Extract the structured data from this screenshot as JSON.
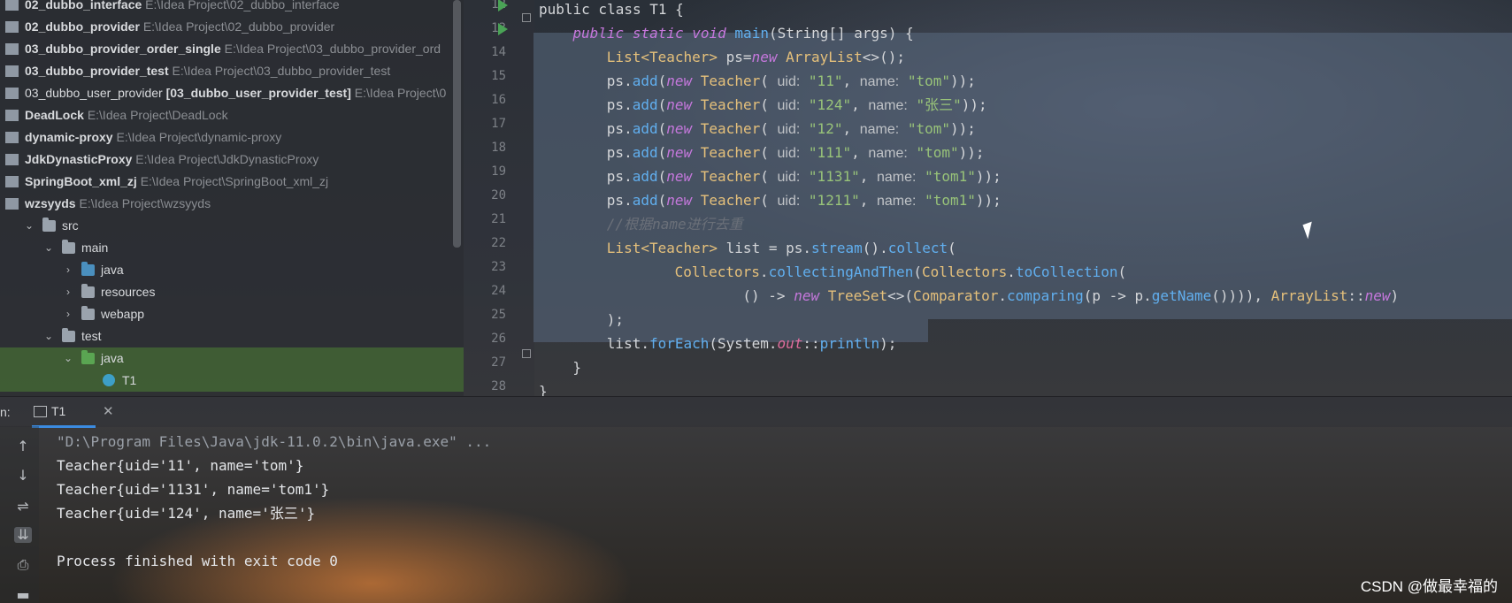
{
  "project_tree": [
    {
      "name": "02_dubbo_interface",
      "path": "E:\\Idea Project\\02_dubbo_interface",
      "bold": true,
      "icon": "module-icon"
    },
    {
      "name": "02_dubbo_provider",
      "path": "E:\\Idea Project\\02_dubbo_provider",
      "bold": true,
      "icon": "module-icon"
    },
    {
      "name": "03_dubbo_provider_order_single",
      "path": "E:\\Idea Project\\03_dubbo_provider_ord",
      "bold": true,
      "icon": "module-icon"
    },
    {
      "name": "03_dubbo_provider_test",
      "path": "E:\\Idea Project\\03_dubbo_provider_test",
      "bold": true,
      "icon": "module-icon"
    },
    {
      "name": "03_dubbo_user_provider",
      "qualifier": "[03_dubbo_user_provider_test]",
      "path": "E:\\Idea Project\\0",
      "bold": false,
      "icon": "module-icon"
    },
    {
      "name": "DeadLock",
      "path": "E:\\Idea Project\\DeadLock",
      "bold": true,
      "icon": "module-icon"
    },
    {
      "name": "dynamic-proxy",
      "path": "E:\\Idea Project\\dynamic-proxy",
      "bold": true,
      "icon": "module-icon"
    },
    {
      "name": "JdkDynasticProxy",
      "path": "E:\\Idea Project\\JdkDynasticProxy",
      "bold": true,
      "icon": "module-icon"
    },
    {
      "name": "SpringBoot_xml_zj",
      "path": "E:\\Idea Project\\SpringBoot_xml_zj",
      "bold": true,
      "icon": "module-icon"
    },
    {
      "name": "wzsyyds",
      "path": "E:\\Idea Project\\wzsyyds",
      "bold": true,
      "icon": "module-icon"
    },
    {
      "name": "src",
      "path": "",
      "bold": false,
      "icon": "folder-icon"
    },
    {
      "name": "main",
      "path": "",
      "bold": false,
      "icon": "folder-icon"
    },
    {
      "name": "java",
      "path": "",
      "bold": false,
      "icon": "folder-blue-icon"
    },
    {
      "name": "resources",
      "path": "",
      "bold": false,
      "icon": "resources-folder-icon"
    },
    {
      "name": "webapp",
      "path": "",
      "bold": false,
      "icon": "web-folder-icon"
    },
    {
      "name": "test",
      "path": "",
      "bold": false,
      "icon": "folder-icon"
    },
    {
      "name": "java",
      "path": "",
      "bold": false,
      "icon": "folder-green-icon"
    },
    {
      "name": "T1",
      "path": "",
      "bold": false,
      "icon": "class-icon"
    }
  ],
  "editor": {
    "line_numbers": [
      "12",
      "13",
      "14",
      "15",
      "16",
      "17",
      "18",
      "19",
      "20",
      "21",
      "22",
      "23",
      "24",
      "25",
      "26",
      "27",
      "28"
    ],
    "code": {
      "l12": "public class T1 {",
      "l13": {
        "kw": "public static void ",
        "mth": "main",
        "rest": "(String[] args) {"
      },
      "l14": {
        "cls1": "List<Teacher>",
        "mid": " ps=",
        "kw": "new ",
        "cls2": "ArrayList",
        "rest": "<>();"
      },
      "adds": [
        {
          "uid": "\"11\"",
          "name": "\"tom\""
        },
        {
          "uid": "\"124\"",
          "name": "\"张三\""
        },
        {
          "uid": "\"12\"",
          "name": "\"tom\""
        },
        {
          "uid": "\"111\"",
          "name": "\"tom\""
        },
        {
          "uid": "\"1131\"",
          "name": "\"tom1\""
        },
        {
          "uid": "\"1211\"",
          "name": "\"tom1\""
        }
      ],
      "add_prefix": "ps.",
      "add_method": "add",
      "new_kw": "new ",
      "teacher_cls": "Teacher",
      "uid_hint": "uid:",
      "name_hint": "name:",
      "add_suffix": "));",
      "l21_comment": "//根据name进行去重",
      "l22": {
        "cls": "List<Teacher>",
        "mid": " list = ps.",
        "m1": "stream",
        "mid2": "().",
        "m2": "collect",
        "rest": "("
      },
      "l23": {
        "c1": "Collectors",
        "dot": ".",
        "m1": "collectingAndThen",
        "p": "(",
        "c2": "Collectors",
        "dot2": ".",
        "m2": "toCollection",
        "rest": "("
      },
      "l24": {
        "a": "() -> ",
        "kw": "new ",
        "c1": "TreeSet",
        "b": "<>(",
        "c2": "Comparator",
        "dot": ".",
        "m1": "comparing",
        "c": "(p -> p.",
        "m2": "getName",
        "d": "())))",
        "e": ", ",
        "c3": "ArrayList",
        "f": "::",
        "kw2": "new",
        "g": ")"
      },
      "l25": ");",
      "l26": {
        "a": "list.",
        "m1": "forEach",
        "b": "(System.",
        "sf": "out",
        "c": "::",
        "m2": "println",
        "d": ");"
      },
      "l27": "}",
      "l28": "}"
    }
  },
  "run_panel": {
    "label": "n:",
    "tab_label": "T1",
    "close_symbol": "✕",
    "console": [
      "\"D:\\Program Files\\Java\\jdk-11.0.2\\bin\\java.exe\" ...",
      "Teacher{uid='11', name='tom'}",
      "Teacher{uid='1131', name='tom1'}",
      "Teacher{uid='124', name='张三'}",
      "",
      "Process finished with exit code 0"
    ]
  },
  "watermark": "CSDN @做最幸福的"
}
